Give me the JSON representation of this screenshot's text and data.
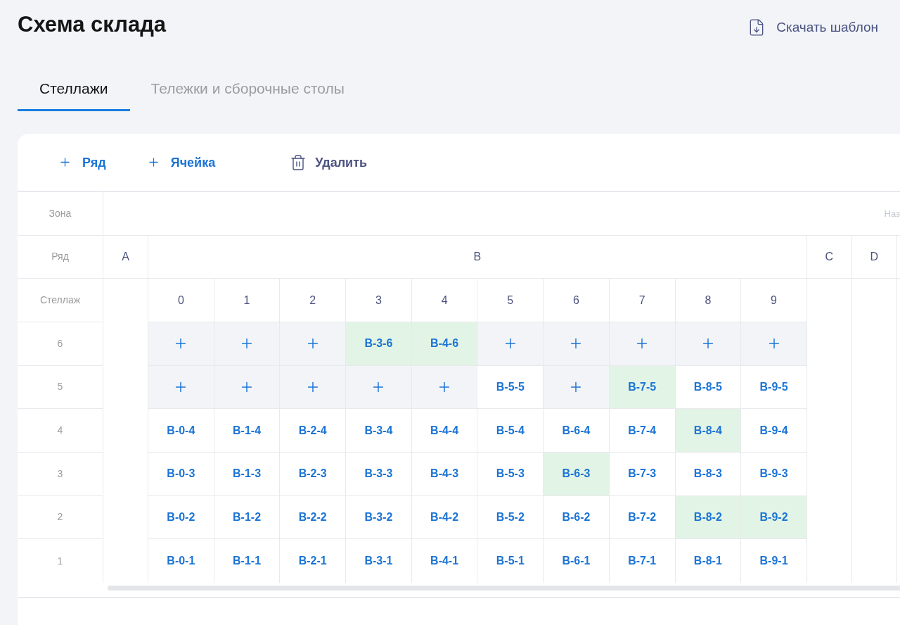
{
  "header": {
    "title": "Схема склада",
    "download_template": "Скачать шаблон"
  },
  "tabs": [
    {
      "label": "Стеллажи",
      "selected": true
    },
    {
      "label": "Тележки и сборочные столы",
      "selected": false
    }
  ],
  "toolbar": [
    {
      "kind": "add",
      "label": "Ряд"
    },
    {
      "kind": "add",
      "label": "Ячейка"
    },
    {
      "kind": "delete",
      "label": "Удалить"
    }
  ],
  "scheme": {
    "headers": {
      "zone": "Зона",
      "row": "Ряд",
      "rack": "Стеллаж"
    },
    "zone_field": {
      "placeholder": "Наз"
    },
    "rows": [
      {
        "label": "A"
      },
      {
        "label": "B",
        "racks": [
          "0",
          "1",
          "2",
          "3",
          "4",
          "5",
          "6",
          "7",
          "8",
          "9"
        ]
      },
      {
        "label": "C"
      },
      {
        "label": "D"
      }
    ],
    "levels": [
      {
        "label": "6",
        "cells": [
          {
            "kind": "add",
            "selected": false
          },
          {
            "kind": "add",
            "selected": false
          },
          {
            "kind": "add",
            "selected": false
          },
          {
            "kind": "cell",
            "code": "B-3-6",
            "selected": true
          },
          {
            "kind": "cell",
            "code": "B-4-6",
            "selected": true
          },
          {
            "kind": "add",
            "selected": false
          },
          {
            "kind": "add",
            "selected": false
          },
          {
            "kind": "add",
            "selected": false
          },
          {
            "kind": "add",
            "selected": false
          },
          {
            "kind": "add",
            "selected": false
          }
        ]
      },
      {
        "label": "5",
        "cells": [
          {
            "kind": "add",
            "selected": false
          },
          {
            "kind": "add",
            "selected": false
          },
          {
            "kind": "add",
            "selected": false
          },
          {
            "kind": "add",
            "selected": false
          },
          {
            "kind": "add",
            "selected": false
          },
          {
            "kind": "cell",
            "code": "B-5-5",
            "selected": false
          },
          {
            "kind": "add",
            "selected": false
          },
          {
            "kind": "cell",
            "code": "B-7-5",
            "selected": true
          },
          {
            "kind": "cell",
            "code": "B-8-5",
            "selected": false
          },
          {
            "kind": "cell",
            "code": "B-9-5",
            "selected": false
          }
        ]
      },
      {
        "label": "4",
        "cells": [
          {
            "kind": "cell",
            "code": "B-0-4",
            "selected": false
          },
          {
            "kind": "cell",
            "code": "B-1-4",
            "selected": false
          },
          {
            "kind": "cell",
            "code": "B-2-4",
            "selected": false
          },
          {
            "kind": "cell",
            "code": "B-3-4",
            "selected": false
          },
          {
            "kind": "cell",
            "code": "B-4-4",
            "selected": false
          },
          {
            "kind": "cell",
            "code": "B-5-4",
            "selected": false
          },
          {
            "kind": "cell",
            "code": "B-6-4",
            "selected": false
          },
          {
            "kind": "cell",
            "code": "B-7-4",
            "selected": false
          },
          {
            "kind": "cell",
            "code": "B-8-4",
            "selected": true
          },
          {
            "kind": "cell",
            "code": "B-9-4",
            "selected": false
          }
        ]
      },
      {
        "label": "3",
        "cells": [
          {
            "kind": "cell",
            "code": "B-0-3",
            "selected": false
          },
          {
            "kind": "cell",
            "code": "B-1-3",
            "selected": false
          },
          {
            "kind": "cell",
            "code": "B-2-3",
            "selected": false
          },
          {
            "kind": "cell",
            "code": "B-3-3",
            "selected": false
          },
          {
            "kind": "cell",
            "code": "B-4-3",
            "selected": false
          },
          {
            "kind": "cell",
            "code": "B-5-3",
            "selected": false
          },
          {
            "kind": "cell",
            "code": "B-6-3",
            "selected": true
          },
          {
            "kind": "cell",
            "code": "B-7-3",
            "selected": false
          },
          {
            "kind": "cell",
            "code": "B-8-3",
            "selected": false
          },
          {
            "kind": "cell",
            "code": "B-9-3",
            "selected": false
          }
        ]
      },
      {
        "label": "2",
        "cells": [
          {
            "kind": "cell",
            "code": "B-0-2",
            "selected": false
          },
          {
            "kind": "cell",
            "code": "B-1-2",
            "selected": false
          },
          {
            "kind": "cell",
            "code": "B-2-2",
            "selected": false
          },
          {
            "kind": "cell",
            "code": "B-3-2",
            "selected": false
          },
          {
            "kind": "cell",
            "code": "B-4-2",
            "selected": false
          },
          {
            "kind": "cell",
            "code": "B-5-2",
            "selected": false
          },
          {
            "kind": "cell",
            "code": "B-6-2",
            "selected": false
          },
          {
            "kind": "cell",
            "code": "B-7-2",
            "selected": false
          },
          {
            "kind": "cell",
            "code": "B-8-2",
            "selected": true
          },
          {
            "kind": "cell",
            "code": "B-9-2",
            "selected": true
          }
        ]
      },
      {
        "label": "1",
        "cells": [
          {
            "kind": "cell",
            "code": "B-0-1",
            "selected": false
          },
          {
            "kind": "cell",
            "code": "B-1-1",
            "selected": false
          },
          {
            "kind": "cell",
            "code": "B-2-1",
            "selected": false
          },
          {
            "kind": "cell",
            "code": "B-3-1",
            "selected": false
          },
          {
            "kind": "cell",
            "code": "B-4-1",
            "selected": false
          },
          {
            "kind": "cell",
            "code": "B-5-1",
            "selected": false
          },
          {
            "kind": "cell",
            "code": "B-6-1",
            "selected": false
          },
          {
            "kind": "cell",
            "code": "B-7-1",
            "selected": false
          },
          {
            "kind": "cell",
            "code": "B-8-1",
            "selected": false
          },
          {
            "kind": "cell",
            "code": "B-9-1",
            "selected": false
          }
        ]
      }
    ]
  }
}
